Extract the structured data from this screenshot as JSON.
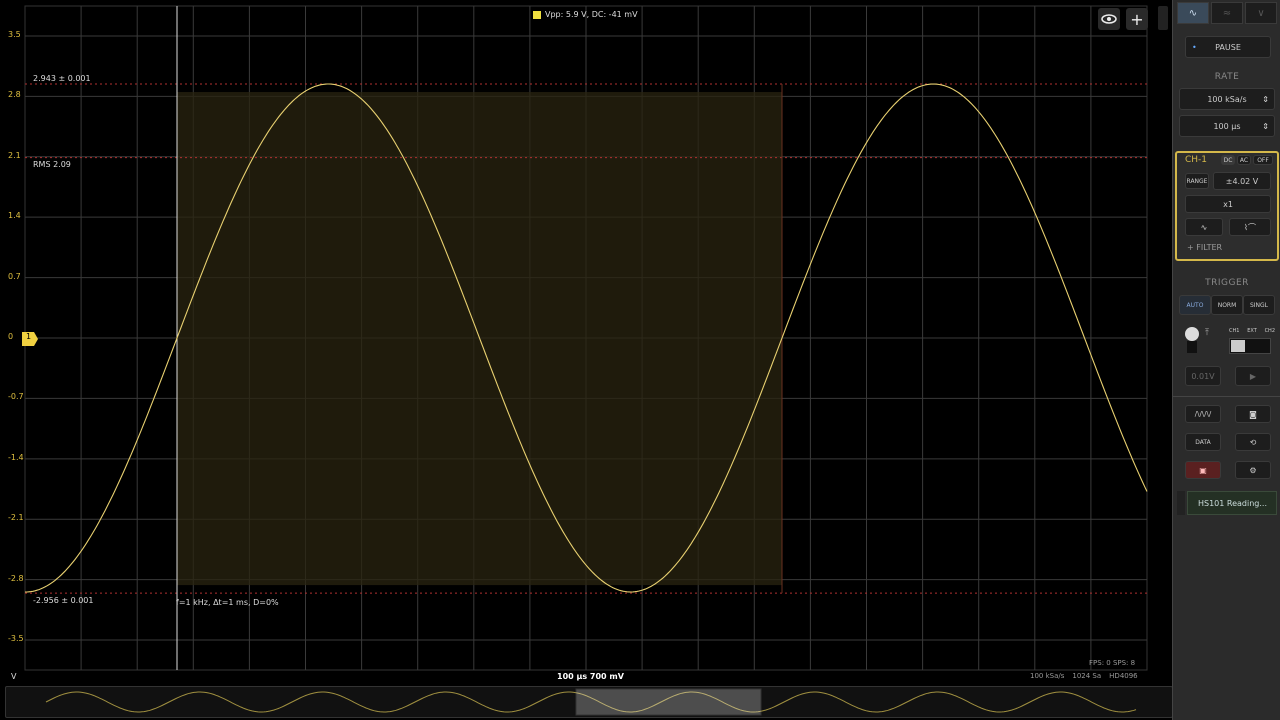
{
  "legend": {
    "text": "Vpp: 5.9 V, DC: -41 mV",
    "color": "#f0e040"
  },
  "y_ticks": [
    "3.5",
    "2.8",
    "2.1",
    "1.4",
    "0.7",
    "0",
    "-0.7",
    "-1.4",
    "-2.1",
    "-2.8",
    "-3.5"
  ],
  "cursors": {
    "upper_label": "2.943 ± 0.001",
    "rms_label": "RMS 2.09",
    "lower_label": "-2.956 ± 0.001",
    "measure_label": "f=1 kHz, Δt=1 ms, D=0%"
  },
  "channel_marker": "1",
  "time_scale": "100 µs  700 mV",
  "unit": "V",
  "fps_sps": "FPS: 0  SPS: 8",
  "bottom_info": [
    "100 kSa/s",
    "1024 Sa",
    "HD4096"
  ],
  "icons": {
    "eye": "eye-icon",
    "plus": "plus-icon"
  },
  "panel": {
    "pause_label": "PAUSE",
    "rate_label": "RATE",
    "rate_value": "100 kSa/s",
    "timebase_value": "100 µs",
    "ch1": {
      "label": "CH-1",
      "coupling": [
        "DC",
        "AC",
        "OFF"
      ],
      "range_label": "RANGE",
      "range_value": "±4.02 V",
      "probe_value": "x1",
      "filter_label": "+ FILTER"
    },
    "trigger_label": "TRIGGER",
    "trigger_modes": [
      "AUTO",
      "NORM",
      "SINGL"
    ],
    "trigger_sources": [
      "CH1",
      "EXT",
      "CH2"
    ],
    "trigger_level": "0.01V",
    "data_label": "DATA",
    "status_text": "HS101 Reading..."
  },
  "colors": {
    "trace": "#e8d070",
    "accent": "#d4b84a",
    "grid": "#3a3a3a",
    "cursor": "#b03030"
  }
}
